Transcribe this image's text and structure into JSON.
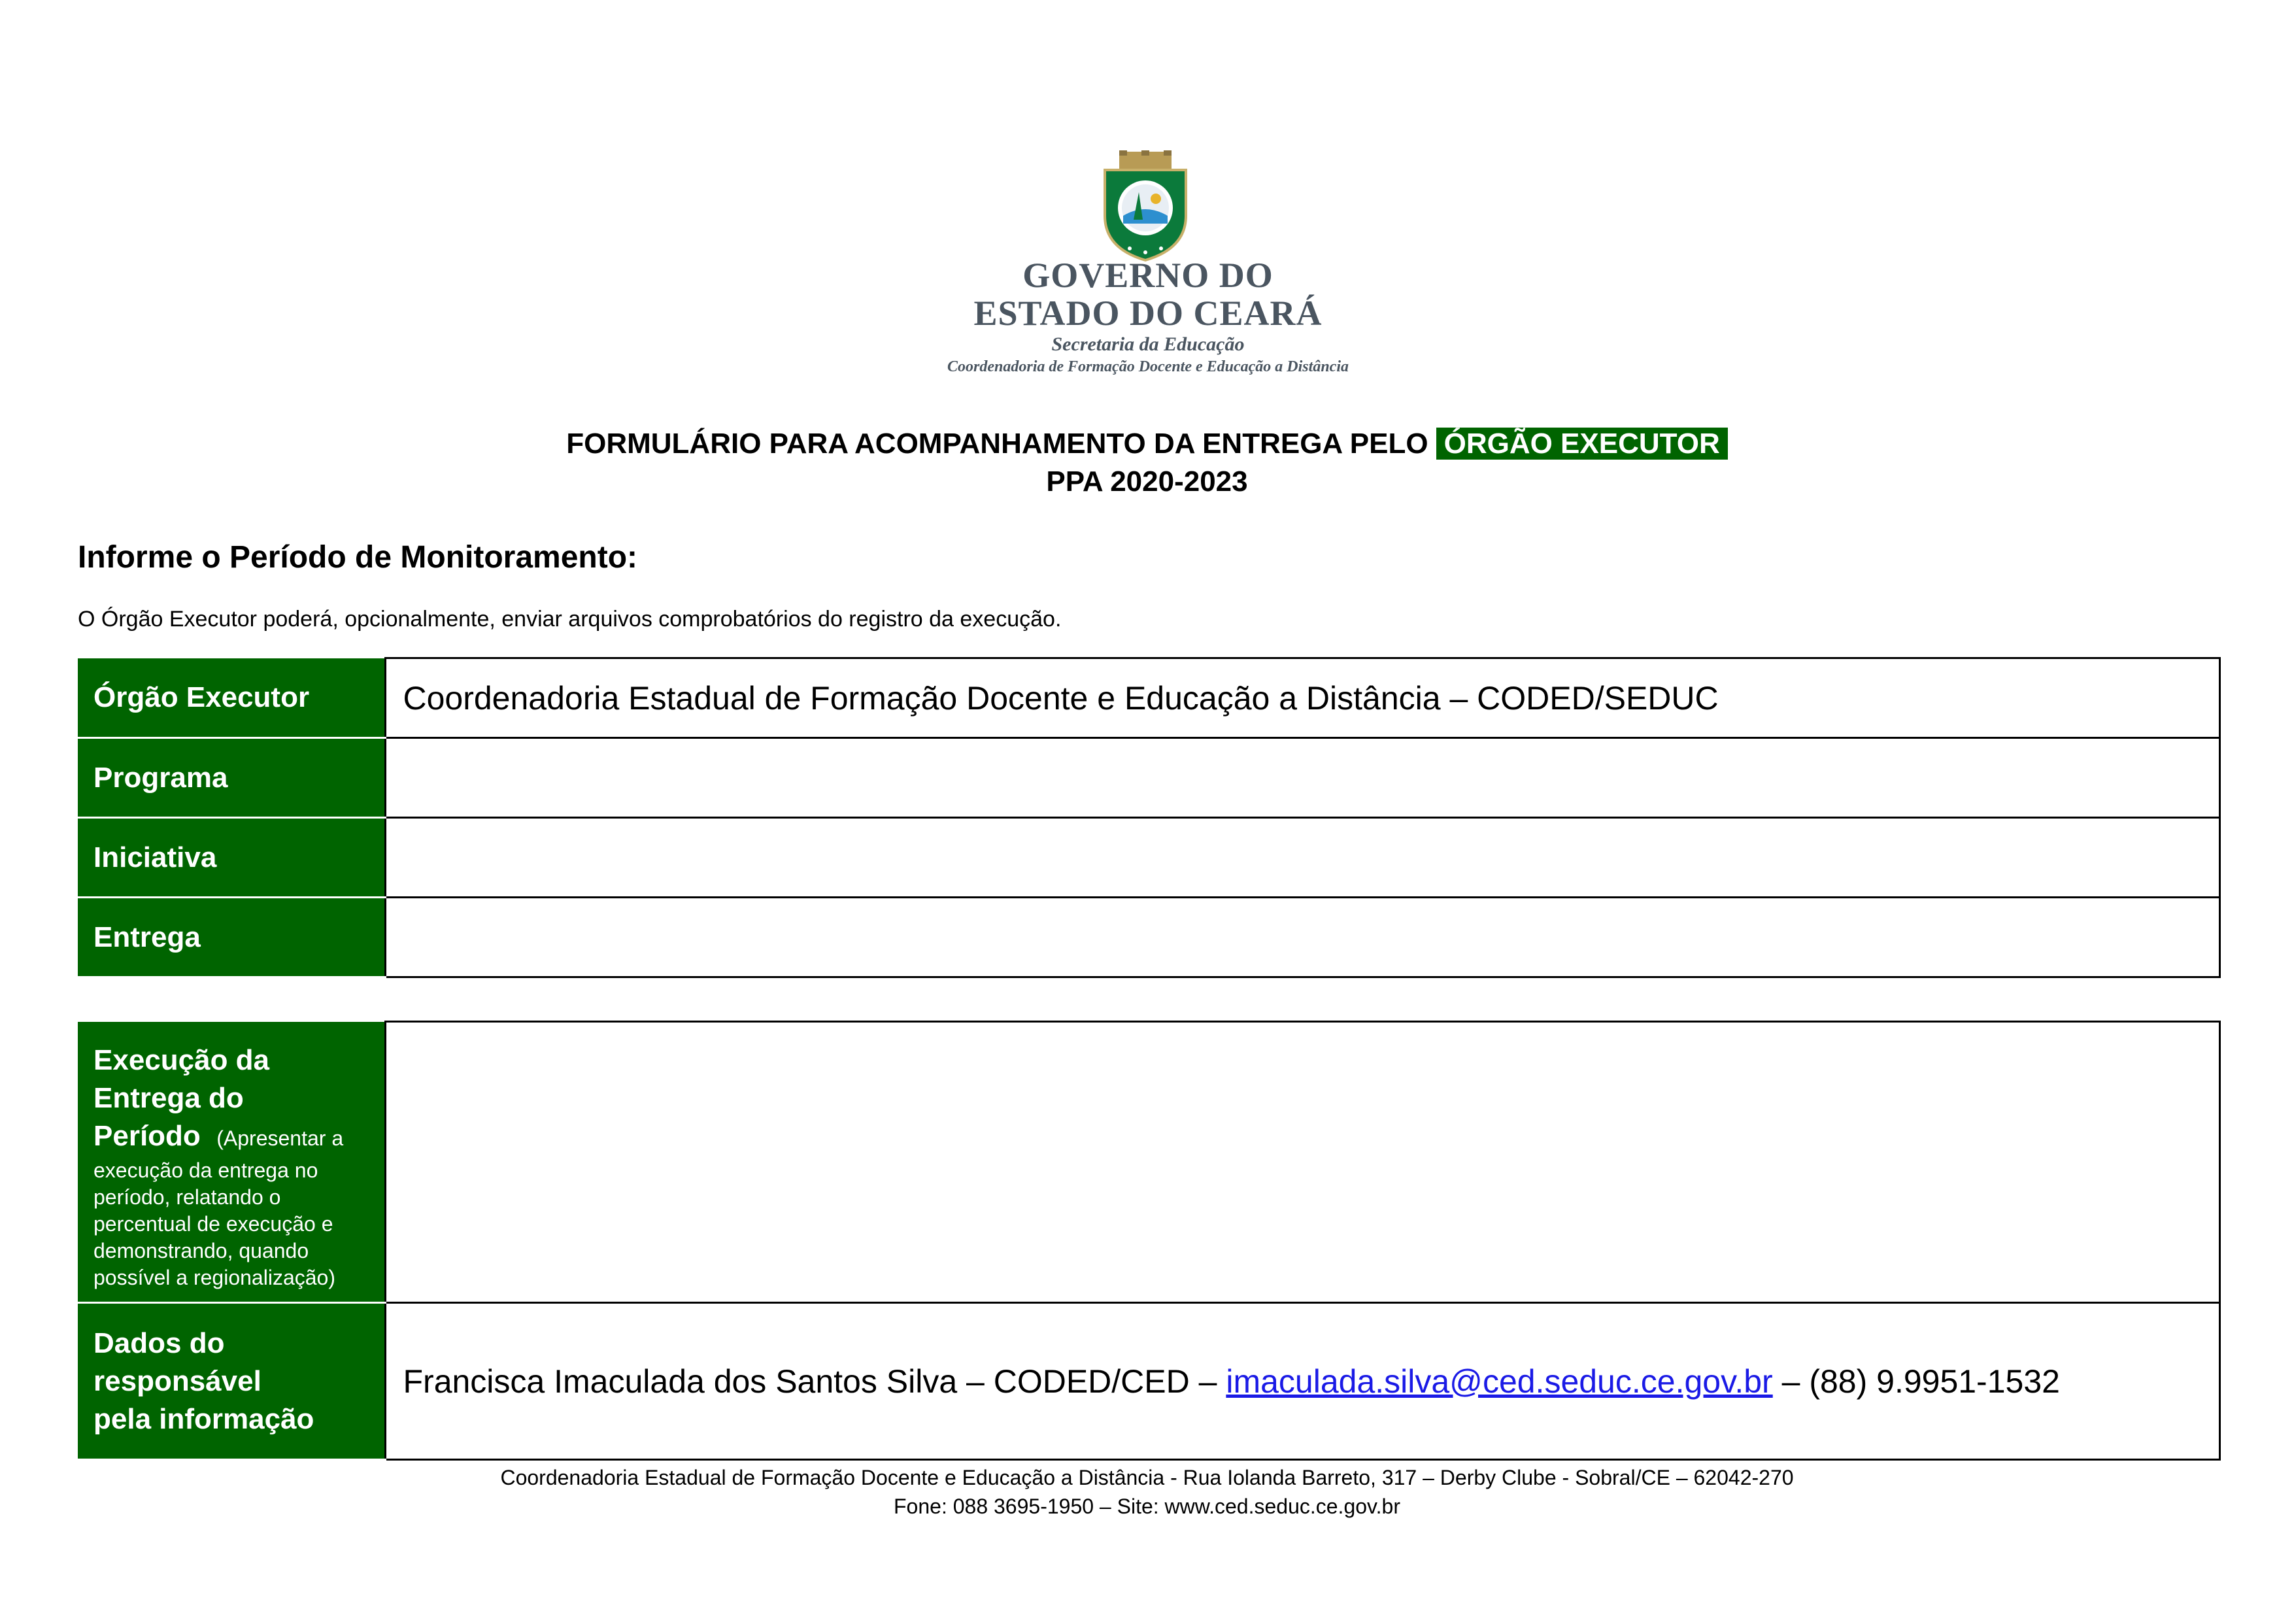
{
  "header": {
    "line1": "GOVERNO DO",
    "line2": "ESTADO DO CEARÁ",
    "secretaria": "Secretaria da Educação",
    "coordenadoria": "Coordenadoria de Formação Docente e Educação a Distância"
  },
  "title": {
    "main": "FORMULÁRIO PARA ACOMPANHAMENTO DA ENTREGA PELO",
    "highlight": "ÓRGÃO EXECUTOR",
    "sub": "PPA 2020-2023"
  },
  "informe": "Informe o Período de Monitoramento:",
  "note": "O Órgão Executor poderá, opcionalmente, enviar arquivos comprobatórios do registro da execução.",
  "table1": {
    "rows": [
      {
        "label": "Órgão Executor",
        "value": "Coordenadoria Estadual de Formação Docente e Educação a Distância – CODED/SEDUC"
      },
      {
        "label": "Programa",
        "value": ""
      },
      {
        "label": "Iniciativa",
        "value": ""
      },
      {
        "label": "Entrega",
        "value": ""
      }
    ]
  },
  "table2": {
    "execucao_label_l1": "Execução da",
    "execucao_label_l2": "Entrega do",
    "execucao_label_l3": "Período",
    "execucao_hint_l1": "(Apresentar a",
    "execucao_hint_rest": [
      "execução da entrega no",
      "período, relatando o",
      "percentual de execução e",
      "demonstrando, quando",
      "possível a regionalização)"
    ],
    "execucao_value": "",
    "dados_label_l1": "Dados do",
    "dados_label_l2": "responsável",
    "dados_label_l3": "pela informação",
    "dados_name": "Francisca Imaculada dos Santos Silva – CODED/CED –",
    "dados_email": "imaculada.silva@ced.seduc.ce.gov.br",
    "dados_phone": "– (88) 9.9951-1532"
  },
  "footer": {
    "line1": "Coordenadoria Estadual de Formação Docente e Educação a Distância - Rua Iolanda Barreto, 317 – Derby Clube -  Sobral/CE – 62042-270",
    "line2": "Fone: 088 3695-1950 – Site: www.ced.seduc.ce.gov.br"
  },
  "colors": {
    "green": "#006400",
    "link": "#1a1ae6"
  }
}
